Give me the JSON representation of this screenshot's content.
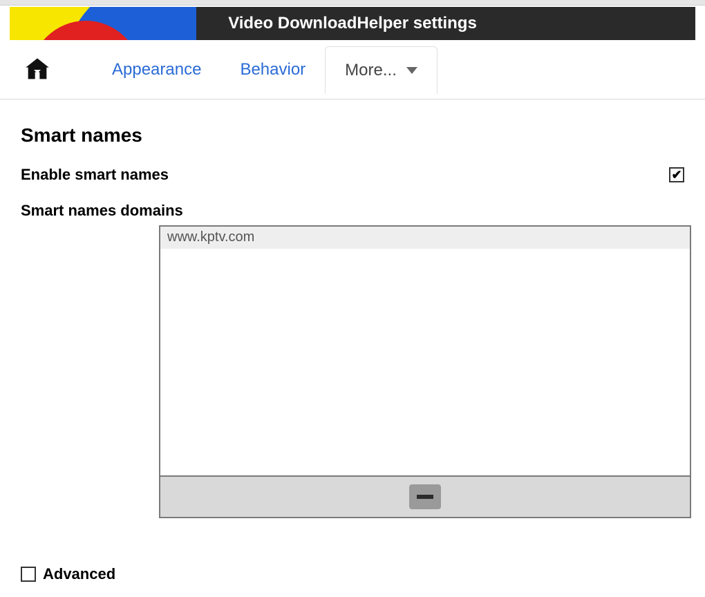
{
  "header": {
    "title": "Video DownloadHelper settings"
  },
  "tabs": {
    "appearance": "Appearance",
    "behavior": "Behavior",
    "more": "More..."
  },
  "section": {
    "title": "Smart names",
    "enable_label": "Enable smart names",
    "enable_checked": true,
    "domains_label": "Smart names domains",
    "domains": [
      "www.kptv.com"
    ]
  },
  "footer": {
    "advanced_label": "Advanced",
    "advanced_checked": false
  }
}
